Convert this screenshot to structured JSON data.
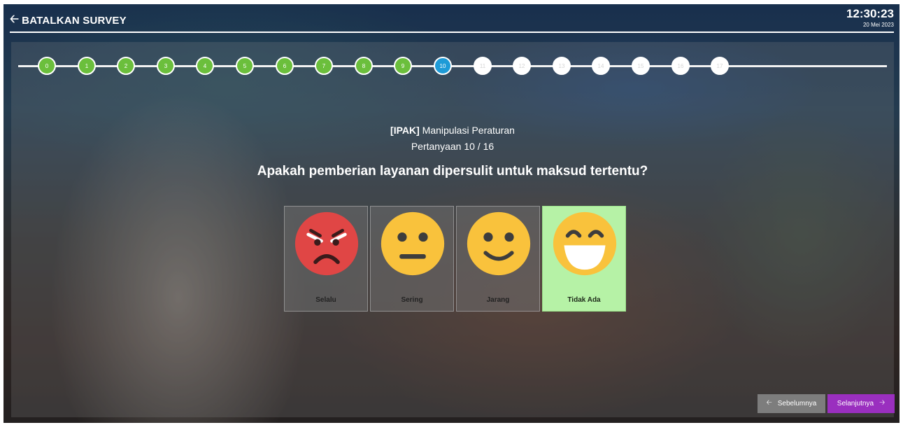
{
  "header": {
    "back_label": "BATALKAN SURVEY",
    "time": "12:30:23",
    "date": "20 Mei 2023"
  },
  "steps": {
    "labels": [
      "0",
      "1",
      "2",
      "3",
      "4",
      "5",
      "6",
      "7",
      "8",
      "9",
      "10",
      "11",
      "12",
      "13",
      "14",
      "15",
      "16",
      "17"
    ],
    "current_index": 10
  },
  "question": {
    "category_tag": "[IPAK]",
    "category_name": "Manipulasi Peraturan",
    "progress": "Pertanyaan 10 / 16",
    "text": "Apakah pemberian layanan dipersulit untuk maksud tertentu?"
  },
  "options": [
    {
      "label": "Selalu",
      "icon": "angry-face-icon"
    },
    {
      "label": "Sering",
      "icon": "neutral-face-icon"
    },
    {
      "label": "Jarang",
      "icon": "smiling-face-icon"
    },
    {
      "label": "Tidak Ada",
      "icon": "grinning-face-icon"
    }
  ],
  "selected_option": "Tidak Ada",
  "nav": {
    "prev_label": "Sebelumnya",
    "next_label": "Selanjutnya"
  },
  "colors": {
    "step_done": "#6bbf3c",
    "step_current": "#1e9bd7",
    "selected_option": "#b6f2a6",
    "next_button": "#9a2fbf",
    "prev_button": "#7d7d7d"
  }
}
